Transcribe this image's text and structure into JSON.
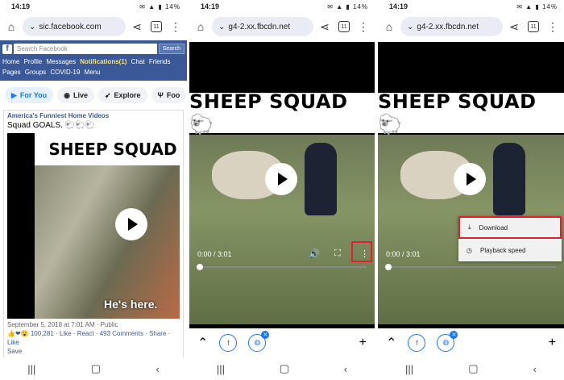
{
  "status": {
    "time": "14:19",
    "battery": "14%"
  },
  "panel1": {
    "url": "sic.facebook.com",
    "tab_count": "11",
    "search_placeholder": "Search Facebook",
    "search_button": "Search",
    "nav_row1": [
      "Home",
      "Profile",
      "Messages",
      "Notifications(1)",
      "Chat",
      "Friends"
    ],
    "nav_row2": [
      "Pages",
      "Groups",
      "COVID-19",
      "Menu"
    ],
    "chips": [
      "For You",
      "Live",
      "Explore",
      "Foo"
    ],
    "post": {
      "author": "America's Funniest Home Videos",
      "text": "Squad GOALS. 🐑🐑🐑",
      "video_banner": "SHEEP SQUAD",
      "video_caption": "He's here.",
      "date": "September 5, 2018 at 7:01 AM · Public",
      "reactions": "100,281",
      "like": "Like",
      "react": "React",
      "comments": "493 Comments",
      "share": "Share",
      "like2": "Like",
      "save": "Save"
    }
  },
  "panel2": {
    "url": "g4-2.xx.fbcdn.net",
    "tab_count": "11",
    "banner": "SHEEP SQUAD 🐑",
    "time": "0:00 / 3:01"
  },
  "panel3": {
    "url": "g4-2.xx.fbcdn.net",
    "tab_count": "11",
    "banner": "SHEEP SQUAD 🐑",
    "time": "0:00 / 3:01",
    "menu": [
      "Download",
      "Playback speed"
    ]
  }
}
